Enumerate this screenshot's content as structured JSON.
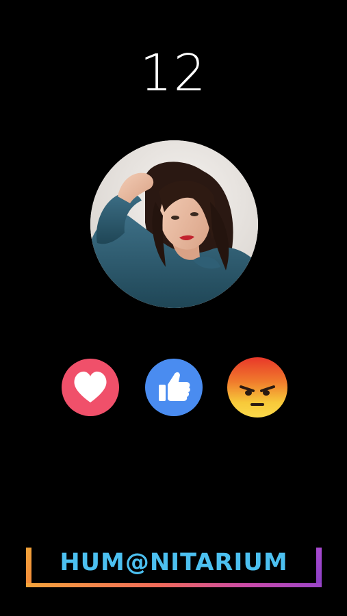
{
  "counter": {
    "value": "12"
  },
  "profile": {
    "photo_icon": "portrait-photo"
  },
  "reactions": [
    {
      "name": "love",
      "icon": "heart-icon",
      "color": "#f0506a"
    },
    {
      "name": "like",
      "icon": "thumbs-up-icon",
      "color": "#4a8cf0"
    },
    {
      "name": "angry",
      "icon": "angry-face-icon",
      "color": "#f07a2c"
    }
  ],
  "branding": {
    "logo_text": "HUM@NITARIUM",
    "text_color": "#4cc0f0"
  }
}
